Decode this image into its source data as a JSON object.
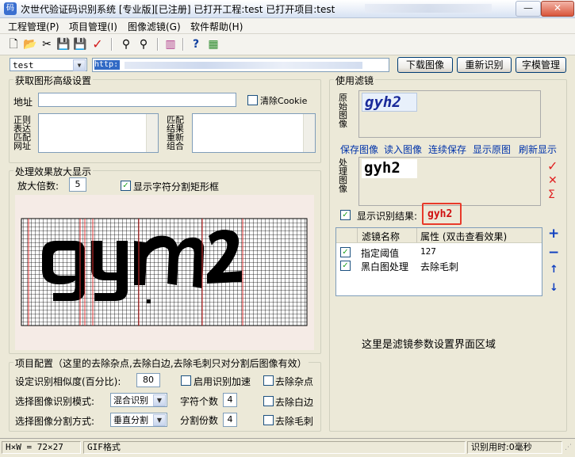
{
  "window": {
    "title": "次世代验证码识别系统 [专业版][已注册] 已打开工程:test 已打开项目:test",
    "minimize": "—",
    "close": "✕"
  },
  "menu": [
    "工程管理(P)",
    "项目管理(I)",
    "图像滤镜(G)",
    "软件帮助(H)"
  ],
  "toolbar": {
    "project_select": "test",
    "url_selected": "http:",
    "download_label": "下载图像",
    "reidentify_label": "重新识别",
    "template_label": "字模管理"
  },
  "advanced": {
    "title": "获取图形高级设置",
    "address_label": "地址",
    "clear_cookie_label": "清除Cookie",
    "post_label": "正则表达匹配网址",
    "match_label": "匹配结果重新组合"
  },
  "zoom": {
    "title": "处理效果放大显示",
    "factor_label": "放大倍数:",
    "factor_value": "5",
    "show_rect_label": "显示字符分割矩形框"
  },
  "project_config": {
    "title": "项目配置（这里的去除杂点,去除白边,去除毛刺只对分割后图像有效）",
    "similarity_label": "设定识别相似度(百分比):",
    "similarity_value": "80",
    "accelerate_label": "启用识别加速",
    "remove_noise_label": "去除杂点",
    "mode_label": "选择图像识别模式:",
    "mode_value": "混合识别",
    "char_count_label": "字符个数",
    "char_count_value": "4",
    "remove_border_label": "去除白边",
    "split_label": "选择图像分割方式:",
    "split_value": "垂直分割",
    "split_count_label": "分割份数",
    "split_count_value": "4",
    "remove_burr_label": "去除毛刺"
  },
  "filter": {
    "title": "使用滤镜",
    "original_label": "原始图像",
    "processed_label": "处理图像",
    "links": [
      "保存图像",
      "读入图像",
      "连续保存",
      "显示原图",
      "刷新显示"
    ],
    "captcha_text": "gyh2",
    "show_result_label": "显示识别结果:",
    "result_value": "gyh2",
    "columns": [
      "滤镜名称",
      "属性 (双击查看效果)"
    ],
    "rows": [
      {
        "name": "指定阈值",
        "attr": "127"
      },
      {
        "name": "黑白图处理",
        "attr": "去除毛刺"
      }
    ],
    "param_area_text": "这里是滤镜参数设置界面区域",
    "side_icons": [
      "✓",
      "✕",
      "Σ"
    ],
    "order_icons": [
      "+",
      "−",
      "↑",
      "↓"
    ]
  },
  "status": {
    "size": "H×W = 72×27",
    "format": "GIF格式",
    "time": "识别用时:0毫秒"
  }
}
